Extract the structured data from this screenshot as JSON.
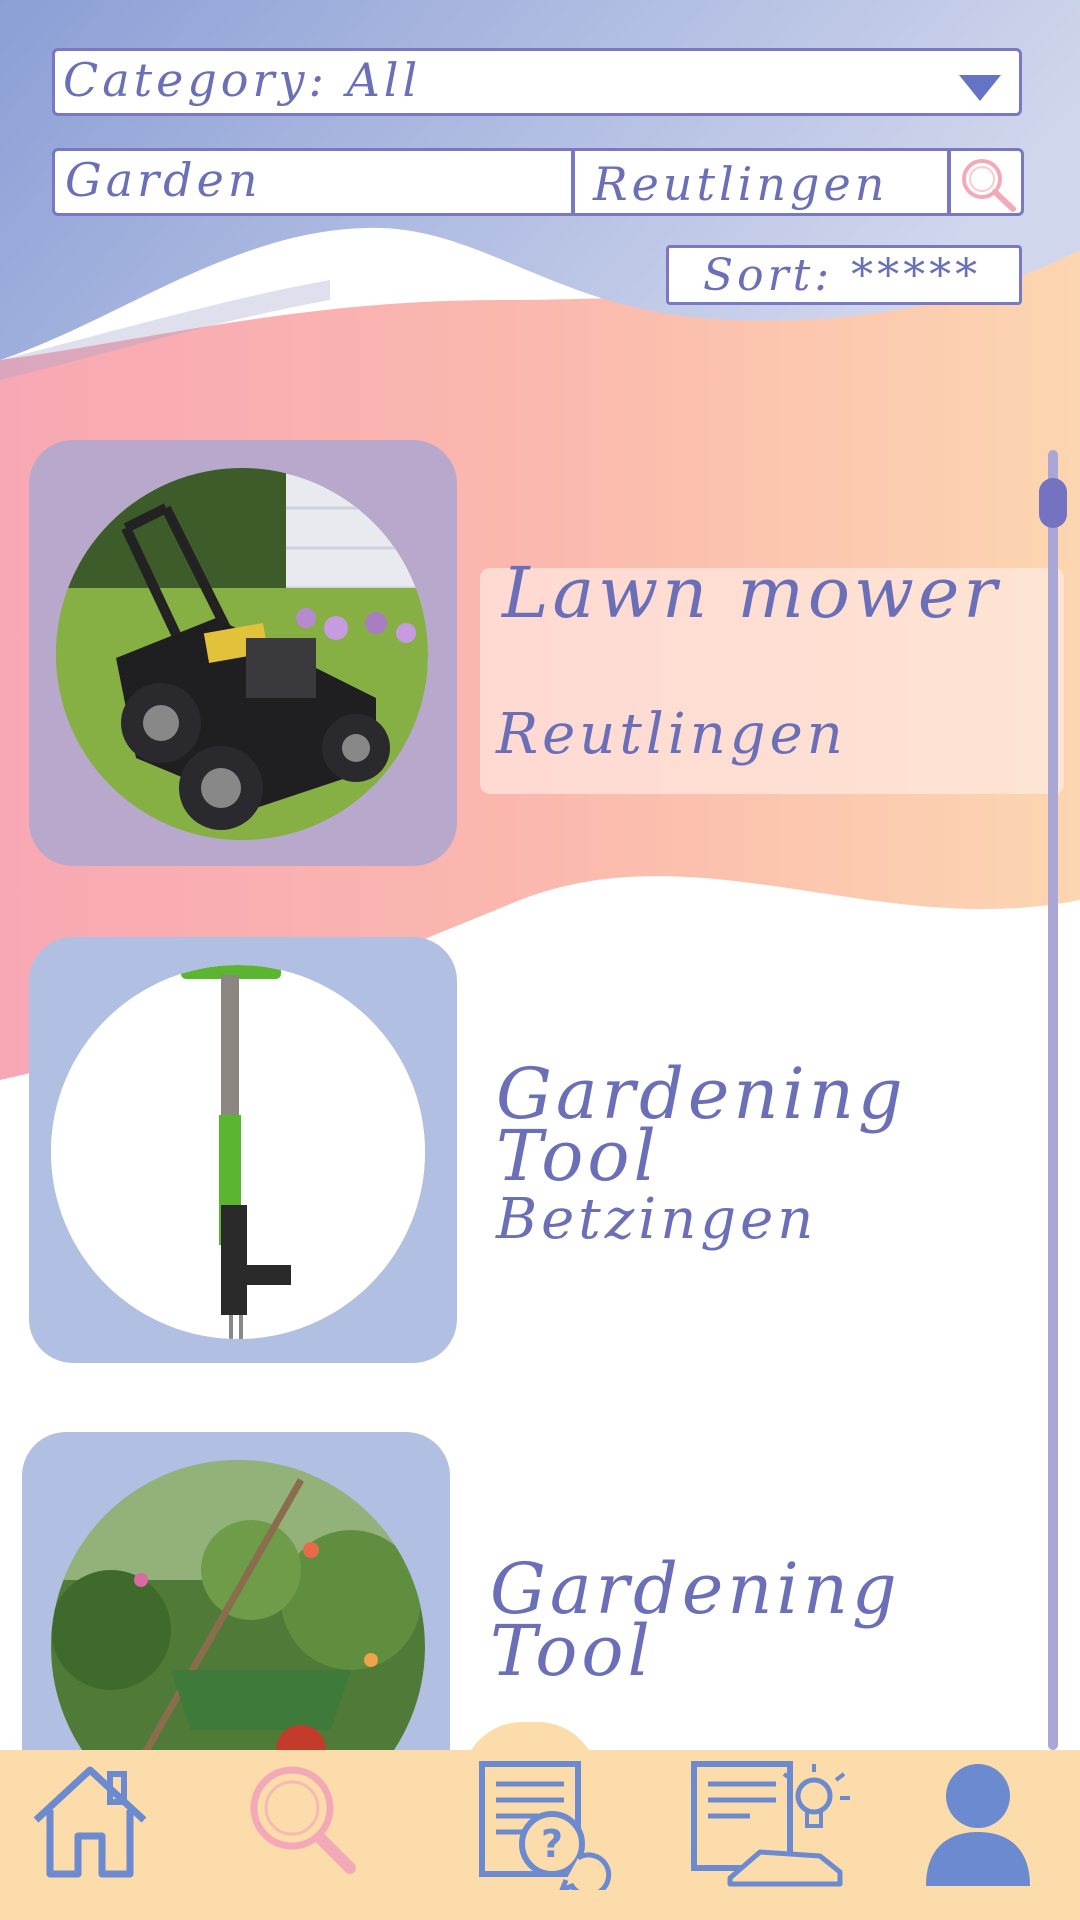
{
  "filters": {
    "category_label": "Category: All",
    "search_keyword": "Garden",
    "search_location": "Reutlingen",
    "sort_label": "Sort: *****"
  },
  "listings": [
    {
      "title": "Lawn mower",
      "location": "Reutlingen",
      "image": "lawn-mower-photo"
    },
    {
      "title": "Gardening Tool",
      "location": "Betzingen",
      "image": "weeder-tool-photo"
    },
    {
      "title": "Gardening Tool",
      "location": "",
      "image": "garden-wheelbarrow-photo"
    }
  ],
  "nav": {
    "items": [
      "home-icon",
      "search-icon",
      "help-document-icon",
      "idea-document-icon",
      "profile-icon"
    ],
    "active": "search-icon"
  },
  "colors": {
    "accent": "#6b6fb8",
    "nav_background": "#fcdcaa",
    "card_purple": "#b8a8cc",
    "card_blue": "#b0bfe2",
    "search_pink": "#f4a9b8"
  }
}
